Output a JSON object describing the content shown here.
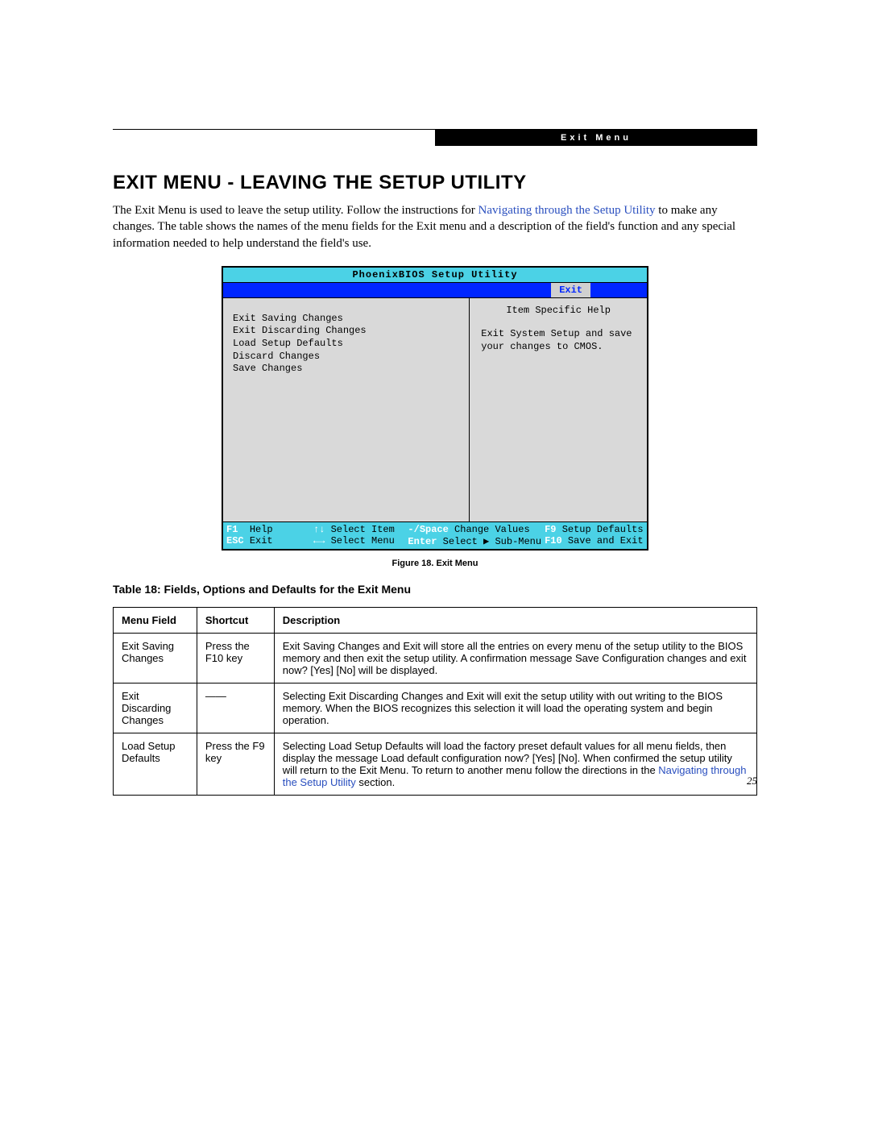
{
  "header_label": "Exit Menu",
  "title": "Exit Menu - Leaving the Setup Utility",
  "intro_1": "The Exit Menu is used to leave the setup utility. Follow the instructions for ",
  "intro_link": "Navigating through the Setup Utility",
  "intro_2": " to make any changes. The table shows the names of the menu fields for the Exit menu and a description of the field's function and any special information needed to help understand the field's use.",
  "bios": {
    "title": "PhoenixBIOS Setup Utility",
    "tab": "Exit",
    "menu_items": [
      "Exit Saving Changes",
      "Exit Discarding Changes",
      "Load Setup Defaults",
      "Discard Changes",
      "Save Changes"
    ],
    "help_head": "Item Specific Help",
    "help_body": "Exit System Setup and save your changes to CMOS.",
    "footer": {
      "r1c1_k": "F1",
      "r1c1_v": "Help",
      "r1c2_k": "↑↓",
      "r1c2_v": "Select Item",
      "r1c3_k": "-/Space",
      "r1c3_v": "Change Values",
      "r1c4_k": "F9",
      "r1c4_v": "Setup Defaults",
      "r2c1_k": "ESC",
      "r2c1_v": "Exit",
      "r2c2_k": "←→",
      "r2c2_v": "Select Menu",
      "r2c3_k": "Enter",
      "r2c3_v": "Select ▶ Sub-Menu",
      "r2c4_k": "F10",
      "r2c4_v": "Save and Exit"
    }
  },
  "figure_caption": "Figure 18.  Exit Menu",
  "table_title": "Table 18: Fields, Options and Defaults for the Exit Menu",
  "table": {
    "headers": {
      "menu": "Menu Field",
      "shortcut": "Shortcut",
      "desc": "Description"
    },
    "rows": [
      {
        "menu": "Exit Saving Changes",
        "shortcut": "Press the F10 key",
        "desc": "Exit Saving Changes and Exit will store all the entries on every menu of the setup utility to the BIOS memory and then exit the setup utility. A confirmation message Save Configuration changes and exit now? [Yes] [No] will be displayed."
      },
      {
        "menu": "Exit Discarding Changes",
        "shortcut": "——",
        "desc": "Selecting Exit Discarding Changes and Exit will exit the setup utility with out writing to the BIOS memory. When the BIOS recognizes this selection it will load the operating system and begin operation."
      },
      {
        "menu": "Load Setup Defaults",
        "shortcut": "Press the F9 key",
        "desc_pre": "Selecting Load Setup Defaults will load the factory preset default values for all menu fields, then display the message Load default configuration now? [Yes] [No]. When confirmed the setup utility will return to the Exit Menu. To return to another menu follow the directions in the ",
        "desc_link": "Navigating through the Setup Utility",
        "desc_post": " section."
      }
    ]
  },
  "page_number": "25"
}
